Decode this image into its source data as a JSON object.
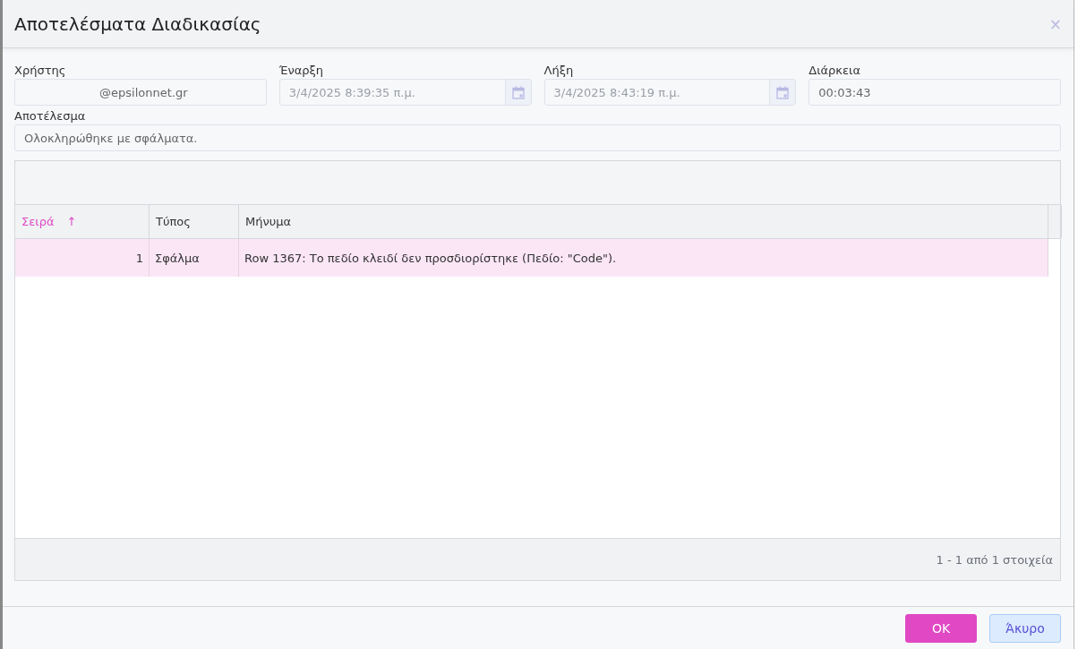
{
  "window": {
    "title": "Αποτελέσματα Διαδικασίας",
    "close": "×"
  },
  "fields": [
    {
      "label": "Χρήστης",
      "value": "@epsilonnet.gr",
      "kind": "text",
      "disabled": false
    },
    {
      "label": "Έναρξη",
      "value": "3/4/2025 8:39:35 π.μ.",
      "kind": "date",
      "disabled": true
    },
    {
      "label": "Λήξη",
      "value": "3/4/2025 8:43:19 π.μ.",
      "kind": "date",
      "disabled": true
    },
    {
      "label": "Διάρκεια",
      "value": "00:03:43",
      "kind": "text",
      "disabled": false
    }
  ],
  "result": {
    "label": "Αποτέλεσμα",
    "value": "Ολοκληρώθηκε με σφάλματα."
  },
  "table": {
    "columns": [
      {
        "label": "Σειρά",
        "sorted": true,
        "sort_mark": "↑"
      },
      {
        "label": "Τύπος",
        "sorted": false
      },
      {
        "label": "Μήνυμα",
        "sorted": false
      }
    ],
    "rows": [
      {
        "cells": [
          "1",
          "Σφάλμα",
          "Row 1367: Το πεδίο κλειδί δεν προσδιορίστηκε (Πεδίο: \"Code\")."
        ],
        "selected": true
      }
    ],
    "pager": "1 - 1 από 1 στοιχεία"
  },
  "buttons": [
    {
      "label": "OK",
      "kind": "primary"
    },
    {
      "label": "Άκυρο",
      "kind": "secondary"
    }
  ]
}
